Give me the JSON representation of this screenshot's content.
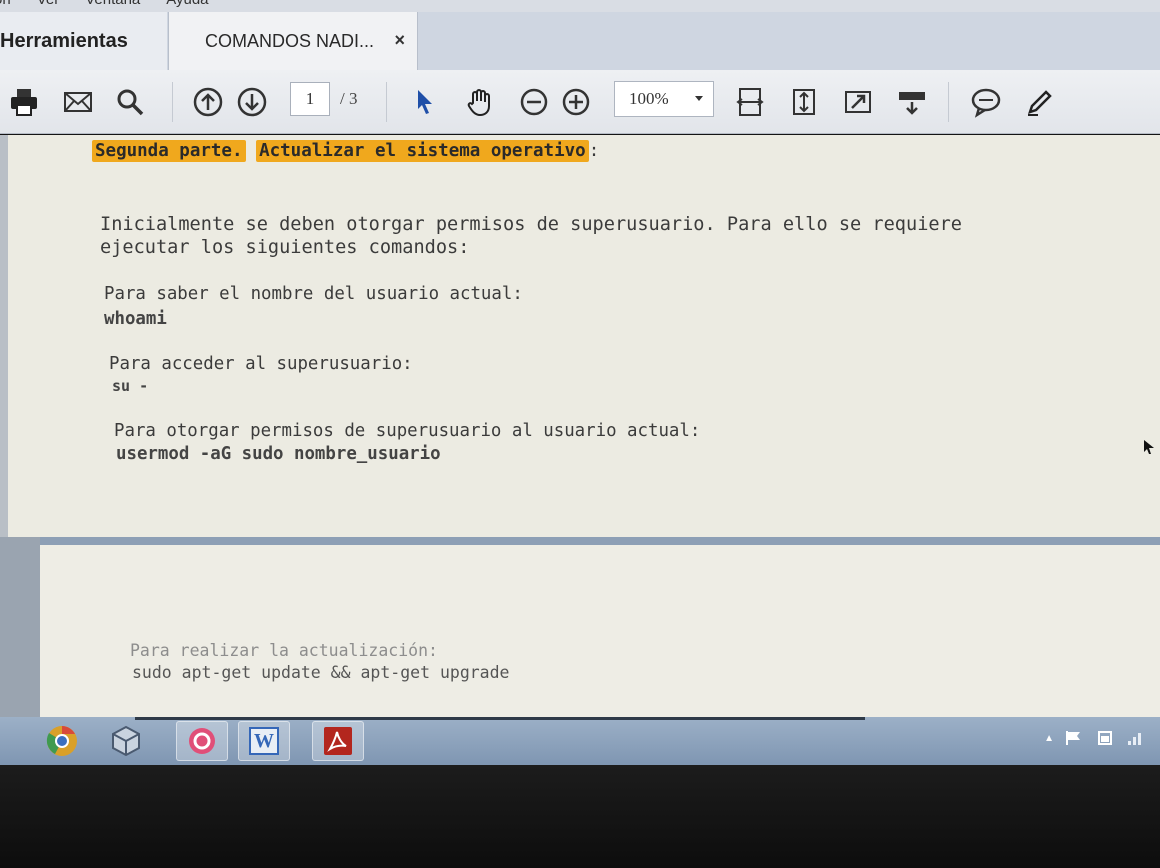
{
  "menu": {
    "items": [
      "on",
      "Ver",
      "Ventana",
      "Ayuda"
    ]
  },
  "tabs": {
    "tools_label": "Herramientas",
    "document_label": "COMANDOS NADI...",
    "close_glyph": "×"
  },
  "toolbar": {
    "page_current": "1",
    "page_total": "/ 3",
    "zoom": "100%"
  },
  "document": {
    "heading_part": "Segunda parte.",
    "heading_title": "Actualizar el sistema operativo",
    "heading_colon": ":",
    "intro_line1": "Inicialmente se deben otorgar permisos de superusuario. Para ello se requiere",
    "intro_line2": "ejecutar los siguientes comandos:",
    "steps": [
      {
        "label": "Para saber el nombre del usuario actual:",
        "command": "whoami"
      },
      {
        "label": "Para acceder al superusuario:",
        "command": "su -"
      },
      {
        "label": "Para otorgar permisos de superusuario al usuario actual:",
        "command": "usermod -aG sudo nombre_usuario"
      }
    ],
    "page2": {
      "label": "Para realizar la actualización:",
      "command": "sudo apt-get update && apt-get upgrade"
    }
  },
  "taskbar": {
    "apps": [
      "chrome-icon",
      "virtualbox-icon",
      "app-icon",
      "word-icon",
      "acrobat-icon"
    ],
    "word_letter": "W"
  },
  "colors": {
    "highlight": "#f0a81d",
    "page_bg": "#ecebe2",
    "taskbar": "#8ea4bd"
  }
}
